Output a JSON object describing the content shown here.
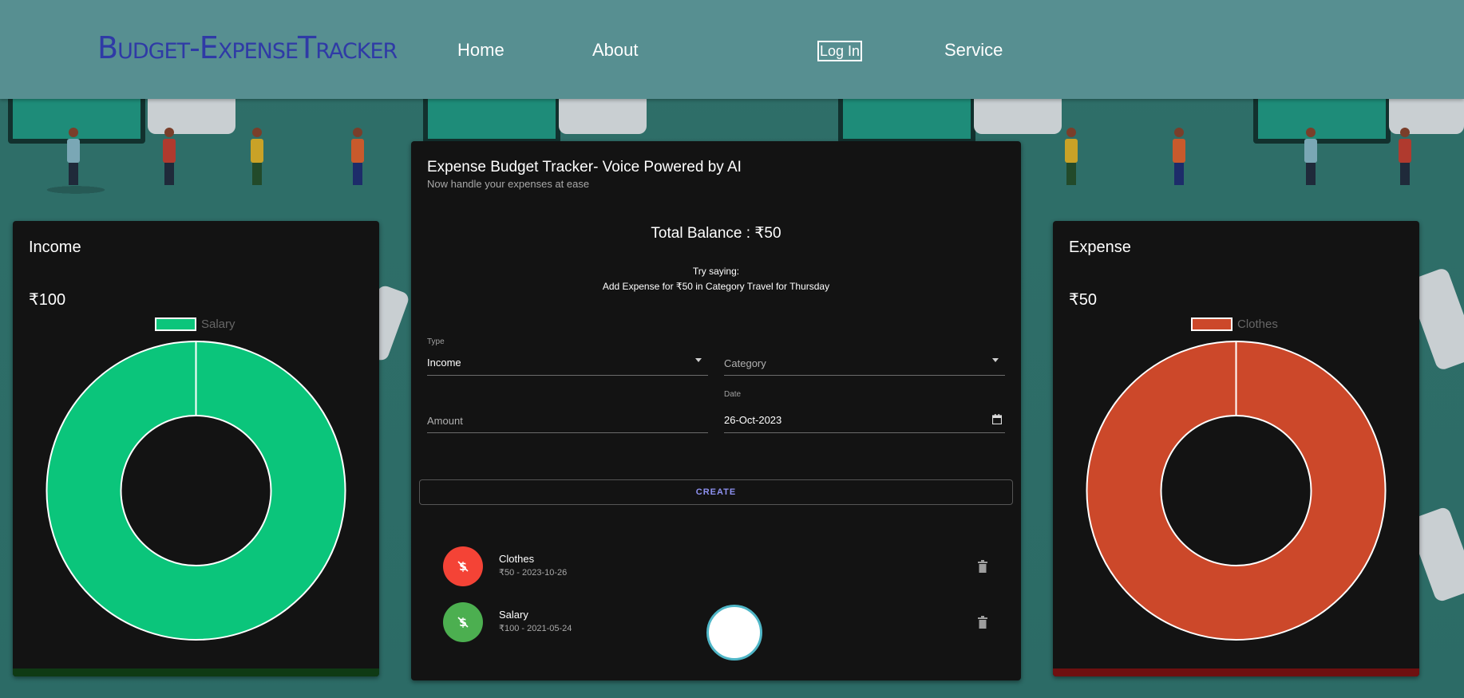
{
  "navbar": {
    "brand": "Budget-ExpenseTracker",
    "links": [
      "Home",
      "About",
      "Log In",
      "Service"
    ]
  },
  "income_card": {
    "title": "Income",
    "amount": "₹100",
    "legend_label": "Salary",
    "color": "#0bc57b",
    "bar_color": "#0f3a14"
  },
  "expense_card": {
    "title": "Expense",
    "amount": "₹50",
    "legend_label": "Clothes",
    "color": "#cc482a",
    "bar_color": "#6e1010"
  },
  "main": {
    "title": "Expense Budget Tracker- Voice Powered by AI",
    "subtitle": "Now handle your expenses at ease",
    "balance": "Total Balance : ₹50",
    "try_saying": "Try saying:",
    "example": "Add Expense for ₹50 in Category Travel for Thursday",
    "form": {
      "type_label": "Type",
      "type_value": "Income",
      "category_placeholder": "Category",
      "amount_placeholder": "Amount",
      "date_label": "Date",
      "date_value": "26-Oct-2023",
      "create_label": "CREATE"
    },
    "transactions": [
      {
        "name": "Clothes",
        "meta": "₹50 - 2023-10-26",
        "color": "#f44336",
        "icon": "dollar-off-icon"
      },
      {
        "name": "Salary",
        "meta": "₹100 - 2021-05-24",
        "color": "#4caf50",
        "icon": "dollar-off-icon"
      }
    ]
  },
  "chart_data": [
    {
      "type": "pie",
      "categories": [
        "Salary"
      ],
      "values": [
        100
      ],
      "colors": [
        "#0bc57b"
      ],
      "legend": "top"
    },
    {
      "type": "pie",
      "categories": [
        "Clothes"
      ],
      "values": [
        50
      ],
      "colors": [
        "#cc482a"
      ],
      "legend": "top"
    }
  ]
}
